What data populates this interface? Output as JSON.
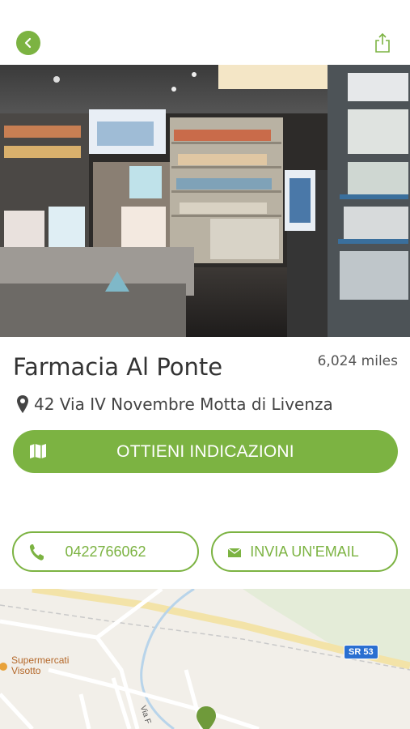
{
  "header": {
    "back_icon": "chevron-left-icon",
    "share_icon": "share-icon"
  },
  "pharmacy": {
    "name": "Farmacia Al Ponte",
    "distance": "6,024 miles",
    "address": "42 Via IV Novembre Motta di Livenza"
  },
  "actions": {
    "directions_label": "OTTIENI INDICAZIONI",
    "phone_label": "0422766062",
    "email_label": "INVIA UN'EMAIL"
  },
  "map": {
    "poi_label_line1": "Supermercati",
    "poi_label_line2": "Visotto",
    "road_badge": "SR 53",
    "street_label": "Via F"
  },
  "colors": {
    "accent": "#7cb342",
    "text": "#333333"
  }
}
